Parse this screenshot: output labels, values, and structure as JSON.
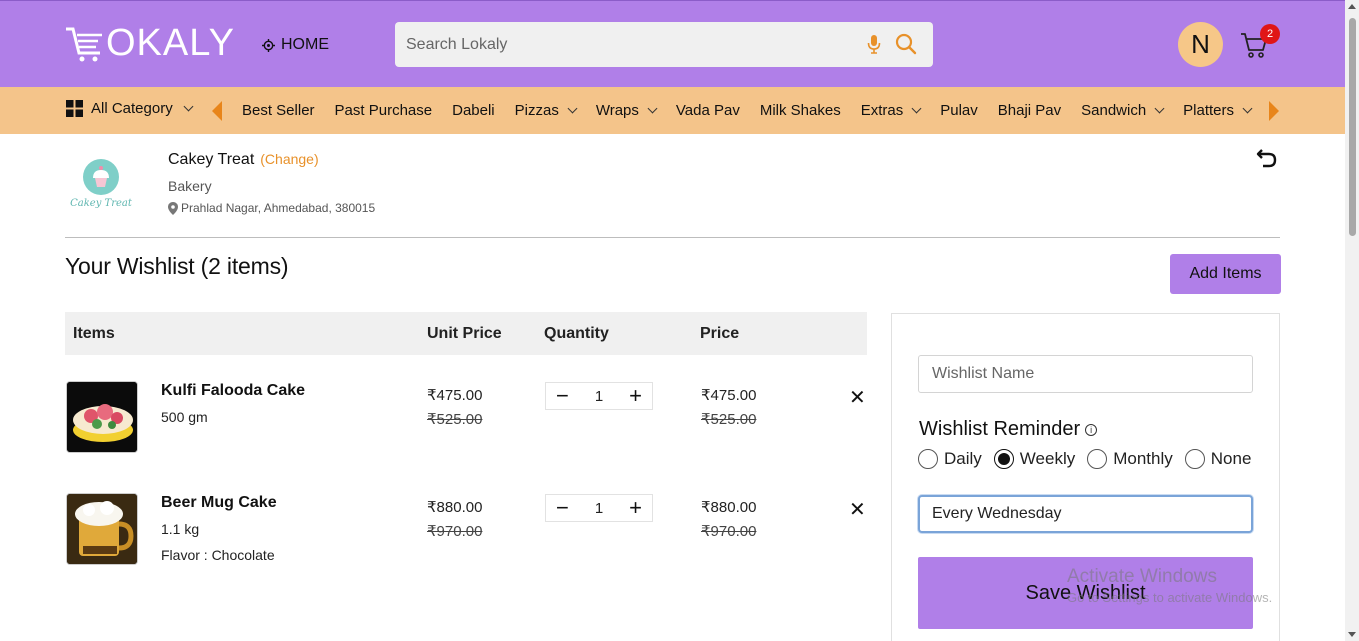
{
  "header": {
    "logo_text": "OKALY",
    "home_label": "HOME",
    "search_placeholder": "Search Lokaly",
    "avatar_initial": "N",
    "cart_count": "2"
  },
  "categories": {
    "all_label": "All Category",
    "items": [
      {
        "label": "Best Seller",
        "dropdown": false
      },
      {
        "label": "Past Purchase",
        "dropdown": false
      },
      {
        "label": "Dabeli",
        "dropdown": false
      },
      {
        "label": "Pizzas",
        "dropdown": true
      },
      {
        "label": "Wraps",
        "dropdown": true
      },
      {
        "label": "Vada Pav",
        "dropdown": false
      },
      {
        "label": "Milk Shakes",
        "dropdown": false
      },
      {
        "label": "Extras",
        "dropdown": true
      },
      {
        "label": "Pulav",
        "dropdown": false
      },
      {
        "label": "Bhaji Pav",
        "dropdown": false
      },
      {
        "label": "Sandwich",
        "dropdown": true
      },
      {
        "label": "Platters",
        "dropdown": true
      }
    ]
  },
  "store": {
    "logo_text": "Cakey Treat",
    "name": "Cakey Treat",
    "change_label": "(Change)",
    "type": "Bakery",
    "address": "Prahlad Nagar, Ahmedabad, 380015"
  },
  "wishlist": {
    "title": "Your Wishlist (2 items)",
    "add_items_label": "Add Items",
    "columns": {
      "items": "Items",
      "unit_price": "Unit Price",
      "quantity": "Quantity",
      "price": "Price"
    },
    "rows": [
      {
        "name": "Kulfi Falooda Cake",
        "weight": "500 gm",
        "flavor": "",
        "unit_price": "₹475.00",
        "unit_mrp": "₹525.00",
        "qty": "1",
        "price": "₹475.00",
        "price_mrp": "₹525.00"
      },
      {
        "name": "Beer Mug Cake",
        "weight": "1.1 kg",
        "flavor": "Flavor : Chocolate",
        "unit_price": "₹880.00",
        "unit_mrp": "₹970.00",
        "qty": "1",
        "price": "₹880.00",
        "price_mrp": "₹970.00"
      }
    ]
  },
  "panel": {
    "name_placeholder": "Wishlist Name",
    "reminder_title": "Wishlist Reminder",
    "options": [
      "Daily",
      "Weekly",
      "Monthly",
      "None"
    ],
    "selected": "Weekly",
    "reminder_value": "Every Wednesday",
    "save_label": "Save Wishlist"
  },
  "overlay": {
    "title": "Activate Windows",
    "subtitle": "Go to Settings to activate Windows."
  },
  "colors": {
    "header_bg": "#b07fe8",
    "catbar_bg": "#f4c48a",
    "accent_orange": "#e8851a",
    "badge_red": "#e01616",
    "avatar_bg": "#f6c788"
  }
}
